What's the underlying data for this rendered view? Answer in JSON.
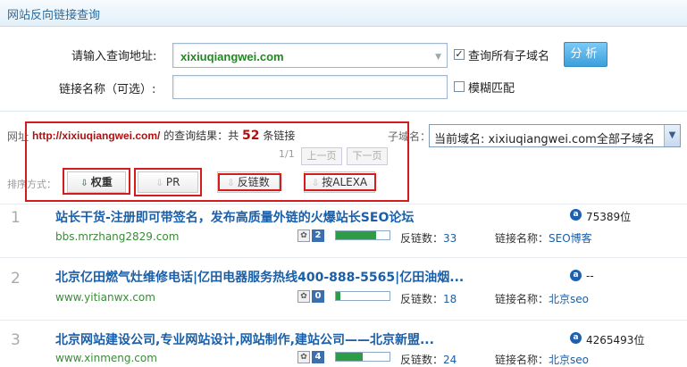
{
  "header": {
    "title": "网站反向链接查询"
  },
  "form": {
    "url_label": "请输入查询地址:",
    "url_value": "xixiuqiangwei.com",
    "name_label": "链接名称（可选）:",
    "name_value": "",
    "all_subdomains_label": "查询所有子域名",
    "all_subdomains_checked": true,
    "fuzzy_label": "模糊匹配",
    "fuzzy_checked": false,
    "analyze_label": "分析"
  },
  "results": {
    "cut_label": "网址",
    "domain": "http://xixiuqiangwei.com/",
    "result_text_1": "的查询结果：共",
    "count": "52",
    "result_text_2": "条链接",
    "subdomain_label": "子域名：",
    "subdomain_select": "当前域名: xixiuqiangwei.com全部子域名",
    "page_info": "1/1",
    "prev_label": "上一页",
    "next_label": "下一页"
  },
  "sort": {
    "label": "排序方式：",
    "buttons": [
      {
        "label": "权重",
        "arrow": "⇩",
        "arrow_color": "#2e9c44",
        "bold": true
      },
      {
        "label": "PR",
        "arrow": "⇩",
        "arrow_color": "#bbbbbb",
        "bold": false
      },
      {
        "label": "反链数",
        "arrow": "⇩",
        "arrow_color": "#bbbbbb",
        "bold": false
      },
      {
        "label": "按ALEXA",
        "arrow": "⇩",
        "arrow_color": "#bbbbbb",
        "bold": false
      }
    ]
  },
  "rows": [
    {
      "num": "1",
      "title": "站长干货-注册即可带签名，发布高质量外链的火爆站长SEO论坛",
      "url": "bbs.mrzhang2829.com",
      "alexa_icon": "alexa-icon",
      "alexa": "75389位",
      "pr": "2",
      "pr_fill": 0.75,
      "backlinks_label": "反链数：",
      "backlinks": "33",
      "linkname_label": "链接名称：",
      "linkname": "SEO博客"
    },
    {
      "num": "2",
      "title": "北京亿田燃气灶维修电话|亿田电器服务热线400-888-5565|亿田油烟...",
      "url": "www.yitianwx.com",
      "alexa_icon": "alexa-icon",
      "alexa": "--",
      "pr": "0",
      "pr_fill": 0.08,
      "backlinks_label": "反链数：",
      "backlinks": "18",
      "linkname_label": "链接名称：",
      "linkname": "北京seo"
    },
    {
      "num": "3",
      "title": "北京网站建设公司,专业网站设计,网站制作,建站公司——北京新盟...",
      "url": "www.xinmeng.com",
      "alexa_icon": "alexa-icon",
      "alexa": "4265493位",
      "pr": "4",
      "pr_fill": 0.5,
      "backlinks_label": "反链数：",
      "backlinks": "24",
      "linkname_label": "链接名称：",
      "linkname": "北京seo"
    }
  ]
}
